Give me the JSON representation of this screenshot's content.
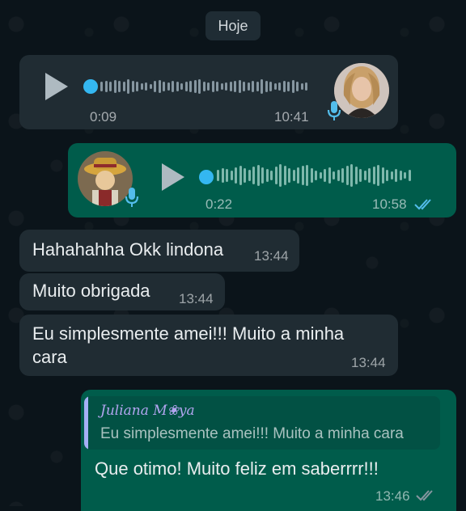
{
  "chat": {
    "date_separator": "Hoje",
    "voice_messages": [
      {
        "direction": "incoming",
        "duration": "0:09",
        "time": "10:41",
        "progress": 0
      },
      {
        "direction": "outgoing",
        "duration": "0:22",
        "time": "10:58",
        "progress": 0,
        "status": "read"
      }
    ],
    "text_messages": [
      {
        "direction": "incoming",
        "text": "Hahahahha Okk lindona",
        "time": "13:44"
      },
      {
        "direction": "incoming",
        "text": "Muito obrigada",
        "time": "13:44"
      },
      {
        "direction": "incoming",
        "text_line1": "Eu simplesmente amei!!! Muito a minha",
        "text_line2": "cara",
        "time": "13:44"
      }
    ],
    "reply": {
      "quoted_author": "Juliana M❀ya",
      "quoted_text": "Eu simplesmente amei!!! Muito a minha cara",
      "text": "Que otimo! Muito feliz em saberrrr!!!",
      "time": "13:46",
      "status": "read"
    }
  },
  "icons": {
    "play": "play-icon",
    "mic": "mic-icon",
    "read_receipt": "double-check-icon"
  },
  "colors": {
    "background": "#0b141a",
    "incoming_bubble": "#202c33",
    "outgoing_bubble": "#005c4b",
    "read_tick": "#53bdeb",
    "mic_accent": "#53bdeb"
  }
}
